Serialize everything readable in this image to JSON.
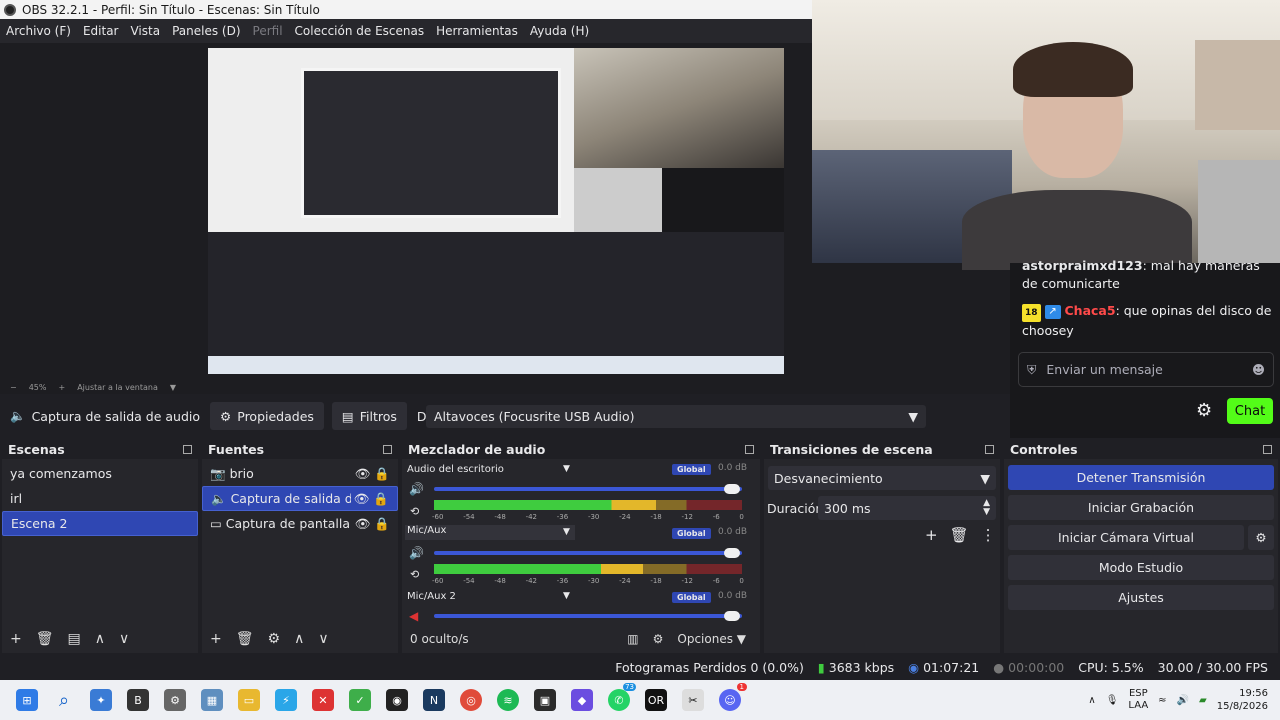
{
  "window": {
    "title": "OBS 32.2.1 - Perfil: Sin Título - Escenas: Sin Título"
  },
  "menu": {
    "items": [
      "Archivo (F)",
      "Editar",
      "Vista",
      "Paneles (D)",
      "Perfil",
      "Colección de Escenas",
      "Herramientas",
      "Ayuda (H)"
    ]
  },
  "preview": {
    "zoom": "45%",
    "fit_label": "Ajustar a la ventana"
  },
  "chat": {
    "msg1_user": "astorpraimxd123",
    "msg1_text": ": mal hay maneras de comunicarte",
    "msg2_badge": "18",
    "msg2_user": "Chaca5",
    "msg2_text": ": que opinas del disco de choosey",
    "input_placeholder": "Enviar un mensaje",
    "send_label": "Chat"
  },
  "source_toolbar": {
    "source_name": "Captura de salida de audio",
    "properties": "Propiedades",
    "filters": "Filtros",
    "device_label": "Dispositivo",
    "device_value": "Altavoces (Focusrite USB Audio)"
  },
  "scenes": {
    "title": "Escenas",
    "items": [
      "ya comenzamos",
      "irl",
      "Escena 2"
    ],
    "selected": 2
  },
  "sources": {
    "title": "Fuentes",
    "items": [
      "brio",
      "Captura de salida de audio",
      "Captura de pantalla"
    ],
    "selected": 1
  },
  "mixer": {
    "title": "Mezclador de audio",
    "channels": [
      {
        "name": "Audio del escritorio",
        "badge": "Global",
        "db": "0.0 dB",
        "level": 0.72
      },
      {
        "name": "Mic/Aux",
        "badge": "Global",
        "db": "0.0 dB",
        "level": 0.68
      },
      {
        "name": "Mic/Aux 2",
        "badge": "Global",
        "db": "0.0 dB",
        "level": 0
      }
    ],
    "scale": [
      "-60",
      "-54",
      "-48",
      "-42",
      "-36",
      "-30",
      "-24",
      "-18",
      "-12",
      "-6",
      "0"
    ],
    "hidden": "0 oculto/s",
    "options": "Opciones"
  },
  "transitions": {
    "title": "Transiciones de escena",
    "type": "Desvanecimiento",
    "duration_label": "Duración",
    "duration_value": "300 ms"
  },
  "controls": {
    "title": "Controles",
    "stop_stream": "Detener Transmisión",
    "start_record": "Iniciar Grabación",
    "virtual_cam": "Iniciar Cámara Virtual",
    "studio_mode": "Modo Estudio",
    "settings": "Ajustes"
  },
  "status": {
    "dropped": "Fotogramas Perdidos 0 (0.0%)",
    "bitrate": "3683 kbps",
    "live_time": "01:07:21",
    "rec_time": "00:00:00",
    "cpu": "CPU: 5.5%",
    "fps": "30.00 / 30.00 FPS"
  },
  "taskbar": {
    "lang1": "ESP",
    "lang2": "LAA",
    "time": "19:56",
    "date": "15/8/2026",
    "whatsapp_count": "73",
    "discord_count": "1"
  },
  "colors": {
    "accent": "#2f47b3",
    "chat_send": "#53fc18"
  }
}
